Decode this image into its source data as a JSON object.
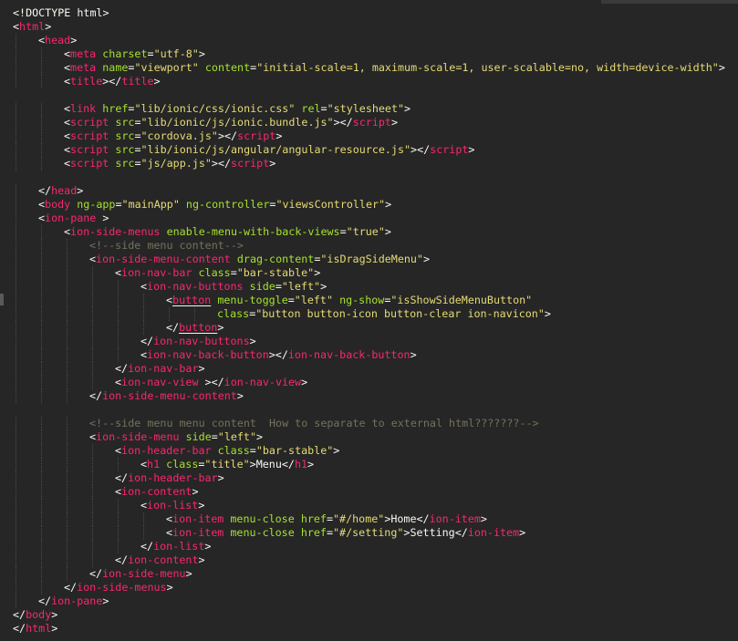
{
  "editor": {
    "theme_colors": {
      "background": "#262626",
      "tag": "#F92672",
      "attribute": "#A6E22E",
      "string": "#E6DB74",
      "text": "#F8F8F2",
      "comment": "#75715E"
    },
    "lines": [
      {
        "indent": 0,
        "tokens": [
          [
            "doctype",
            "<!DOCTYPE html>"
          ]
        ]
      },
      {
        "indent": 0,
        "tokens": [
          [
            "text",
            "<"
          ],
          [
            "tag",
            "html"
          ],
          [
            "text",
            ">"
          ]
        ]
      },
      {
        "indent": 1,
        "tokens": [
          [
            "text",
            "<"
          ],
          [
            "tag",
            "head"
          ],
          [
            "text",
            ">"
          ]
        ]
      },
      {
        "indent": 2,
        "tokens": [
          [
            "text",
            "<"
          ],
          [
            "tag",
            "meta"
          ],
          [
            "text",
            " "
          ],
          [
            "attr",
            "charset"
          ],
          [
            "text",
            "="
          ],
          [
            "str",
            "\"utf-8\""
          ],
          [
            "text",
            ">"
          ]
        ]
      },
      {
        "indent": 2,
        "tokens": [
          [
            "text",
            "<"
          ],
          [
            "tag",
            "meta"
          ],
          [
            "text",
            " "
          ],
          [
            "attr",
            "name"
          ],
          [
            "text",
            "="
          ],
          [
            "str",
            "\"viewport\""
          ],
          [
            "text",
            " "
          ],
          [
            "attr",
            "content"
          ],
          [
            "text",
            "="
          ],
          [
            "str",
            "\"initial-scale=1, maximum-scale=1, user-scalable=no, width=device-width\""
          ],
          [
            "text",
            ">"
          ]
        ]
      },
      {
        "indent": 2,
        "tokens": [
          [
            "text",
            "<"
          ],
          [
            "tag",
            "title"
          ],
          [
            "text",
            "></"
          ],
          [
            "tag",
            "title"
          ],
          [
            "text",
            ">"
          ]
        ]
      },
      {
        "indent": 0,
        "tokens": []
      },
      {
        "indent": 2,
        "tokens": [
          [
            "text",
            "<"
          ],
          [
            "tag",
            "link"
          ],
          [
            "text",
            " "
          ],
          [
            "attr",
            "href"
          ],
          [
            "text",
            "="
          ],
          [
            "str",
            "\"lib/ionic/css/ionic.css\""
          ],
          [
            "text",
            " "
          ],
          [
            "attr",
            "rel"
          ],
          [
            "text",
            "="
          ],
          [
            "str",
            "\"stylesheet\""
          ],
          [
            "text",
            ">"
          ]
        ]
      },
      {
        "indent": 2,
        "tokens": [
          [
            "text",
            "<"
          ],
          [
            "tag",
            "script"
          ],
          [
            "text",
            " "
          ],
          [
            "attr",
            "src"
          ],
          [
            "text",
            "="
          ],
          [
            "str",
            "\"lib/ionic/js/ionic.bundle.js\""
          ],
          [
            "text",
            "></"
          ],
          [
            "tag",
            "script"
          ],
          [
            "text",
            ">"
          ]
        ]
      },
      {
        "indent": 2,
        "tokens": [
          [
            "text",
            "<"
          ],
          [
            "tag",
            "script"
          ],
          [
            "text",
            " "
          ],
          [
            "attr",
            "src"
          ],
          [
            "text",
            "="
          ],
          [
            "str",
            "\"cordova.js\""
          ],
          [
            "text",
            "></"
          ],
          [
            "tag",
            "script"
          ],
          [
            "text",
            ">"
          ]
        ]
      },
      {
        "indent": 2,
        "tokens": [
          [
            "text",
            "<"
          ],
          [
            "tag",
            "script"
          ],
          [
            "text",
            " "
          ],
          [
            "attr",
            "src"
          ],
          [
            "text",
            "="
          ],
          [
            "str",
            "\"lib/ionic/js/angular/angular-resource.js\""
          ],
          [
            "text",
            "></"
          ],
          [
            "tag",
            "script"
          ],
          [
            "text",
            ">"
          ]
        ]
      },
      {
        "indent": 2,
        "tokens": [
          [
            "text",
            "<"
          ],
          [
            "tag",
            "script"
          ],
          [
            "text",
            " "
          ],
          [
            "attr",
            "src"
          ],
          [
            "text",
            "="
          ],
          [
            "str",
            "\"js/app.js\""
          ],
          [
            "text",
            "></"
          ],
          [
            "tag",
            "script"
          ],
          [
            "text",
            ">"
          ]
        ]
      },
      {
        "indent": 0,
        "tokens": []
      },
      {
        "indent": 1,
        "tokens": [
          [
            "text",
            "</"
          ],
          [
            "tag",
            "head"
          ],
          [
            "text",
            ">"
          ]
        ]
      },
      {
        "indent": 1,
        "tokens": [
          [
            "text",
            "<"
          ],
          [
            "tag",
            "body"
          ],
          [
            "text",
            " "
          ],
          [
            "attr",
            "ng-app"
          ],
          [
            "text",
            "="
          ],
          [
            "str",
            "\"mainApp\""
          ],
          [
            "text",
            " "
          ],
          [
            "attr",
            "ng-controller"
          ],
          [
            "text",
            "="
          ],
          [
            "str",
            "\"viewsController\""
          ],
          [
            "text",
            ">"
          ]
        ]
      },
      {
        "indent": 1,
        "tokens": [
          [
            "text",
            "<"
          ],
          [
            "tag",
            "ion-pane"
          ],
          [
            "text",
            " >"
          ]
        ]
      },
      {
        "indent": 2,
        "tokens": [
          [
            "text",
            "<"
          ],
          [
            "tag",
            "ion-side-menus"
          ],
          [
            "text",
            " "
          ],
          [
            "attr",
            "enable-menu-with-back-views"
          ],
          [
            "text",
            "="
          ],
          [
            "str",
            "\"true\""
          ],
          [
            "text",
            ">"
          ]
        ]
      },
      {
        "indent": 3,
        "tokens": [
          [
            "cmt",
            "<!--side menu content-->"
          ]
        ]
      },
      {
        "indent": 3,
        "tokens": [
          [
            "text",
            "<"
          ],
          [
            "tag",
            "ion-side-menu-content"
          ],
          [
            "text",
            " "
          ],
          [
            "attr",
            "drag-content"
          ],
          [
            "text",
            "="
          ],
          [
            "str",
            "\"isDragSideMenu\""
          ],
          [
            "text",
            ">"
          ]
        ]
      },
      {
        "indent": 4,
        "tokens": [
          [
            "text",
            "<"
          ],
          [
            "tag",
            "ion-nav-bar"
          ],
          [
            "text",
            " "
          ],
          [
            "attr",
            "class"
          ],
          [
            "text",
            "="
          ],
          [
            "str",
            "\"bar-stable\""
          ],
          [
            "text",
            ">"
          ]
        ]
      },
      {
        "indent": 5,
        "tokens": [
          [
            "text",
            "<"
          ],
          [
            "tag",
            "ion-nav-buttons"
          ],
          [
            "text",
            " "
          ],
          [
            "attr",
            "side"
          ],
          [
            "text",
            "="
          ],
          [
            "str",
            "\"left\""
          ],
          [
            "text",
            ">"
          ]
        ]
      },
      {
        "indent": 6,
        "tokens": [
          [
            "text",
            "<"
          ],
          [
            "tagul",
            "button"
          ],
          [
            "text",
            " "
          ],
          [
            "attr",
            "menu-toggle"
          ],
          [
            "text",
            "="
          ],
          [
            "str",
            "\"left\""
          ],
          [
            "text",
            " "
          ],
          [
            "attr",
            "ng-show"
          ],
          [
            "text",
            "="
          ],
          [
            "str",
            "\"isShowSideMenuButton\""
          ]
        ]
      },
      {
        "indent": 8,
        "tokens": [
          [
            "attr",
            "class"
          ],
          [
            "text",
            "="
          ],
          [
            "str",
            "\"button button-icon button-clear ion-navicon\""
          ],
          [
            "text",
            ">"
          ]
        ]
      },
      {
        "indent": 6,
        "tokens": [
          [
            "text",
            "</"
          ],
          [
            "tagul",
            "button"
          ],
          [
            "text",
            ">"
          ]
        ]
      },
      {
        "indent": 5,
        "tokens": [
          [
            "text",
            "</"
          ],
          [
            "tag",
            "ion-nav-buttons"
          ],
          [
            "text",
            ">"
          ]
        ]
      },
      {
        "indent": 5,
        "tokens": [
          [
            "text",
            "<"
          ],
          [
            "tag",
            "ion-nav-back-button"
          ],
          [
            "text",
            "></"
          ],
          [
            "tag",
            "ion-nav-back-button"
          ],
          [
            "text",
            ">"
          ]
        ]
      },
      {
        "indent": 4,
        "tokens": [
          [
            "text",
            "</"
          ],
          [
            "tag",
            "ion-nav-bar"
          ],
          [
            "text",
            ">"
          ]
        ]
      },
      {
        "indent": 4,
        "tokens": [
          [
            "text",
            "<"
          ],
          [
            "tag",
            "ion-nav-view"
          ],
          [
            "text",
            " ></"
          ],
          [
            "tag",
            "ion-nav-view"
          ],
          [
            "text",
            ">"
          ]
        ]
      },
      {
        "indent": 3,
        "tokens": [
          [
            "text",
            "</"
          ],
          [
            "tag",
            "ion-side-menu-content"
          ],
          [
            "text",
            ">"
          ]
        ]
      },
      {
        "indent": 0,
        "tokens": []
      },
      {
        "indent": 3,
        "tokens": [
          [
            "cmt",
            "<!--side menu menu content  How to separate to external html???????-->"
          ]
        ]
      },
      {
        "indent": 3,
        "tokens": [
          [
            "text",
            "<"
          ],
          [
            "tag",
            "ion-side-menu"
          ],
          [
            "text",
            " "
          ],
          [
            "attr",
            "side"
          ],
          [
            "text",
            "="
          ],
          [
            "str",
            "\"left\""
          ],
          [
            "text",
            ">"
          ]
        ]
      },
      {
        "indent": 4,
        "tokens": [
          [
            "text",
            "<"
          ],
          [
            "tag",
            "ion-header-bar"
          ],
          [
            "text",
            " "
          ],
          [
            "attr",
            "class"
          ],
          [
            "text",
            "="
          ],
          [
            "str",
            "\"bar-stable\""
          ],
          [
            "text",
            ">"
          ]
        ]
      },
      {
        "indent": 5,
        "tokens": [
          [
            "text",
            "<"
          ],
          [
            "tag",
            "h1"
          ],
          [
            "text",
            " "
          ],
          [
            "attr",
            "class"
          ],
          [
            "text",
            "="
          ],
          [
            "str",
            "\"title\""
          ],
          [
            "text",
            ">Menu</"
          ],
          [
            "tag",
            "h1"
          ],
          [
            "text",
            ">"
          ]
        ]
      },
      {
        "indent": 4,
        "tokens": [
          [
            "text",
            "</"
          ],
          [
            "tag",
            "ion-header-bar"
          ],
          [
            "text",
            ">"
          ]
        ]
      },
      {
        "indent": 4,
        "tokens": [
          [
            "text",
            "<"
          ],
          [
            "tag",
            "ion-content"
          ],
          [
            "text",
            ">"
          ]
        ]
      },
      {
        "indent": 5,
        "tokens": [
          [
            "text",
            "<"
          ],
          [
            "tag",
            "ion-list"
          ],
          [
            "text",
            ">"
          ]
        ]
      },
      {
        "indent": 6,
        "tokens": [
          [
            "text",
            "<"
          ],
          [
            "tag",
            "ion-item"
          ],
          [
            "text",
            " "
          ],
          [
            "attr",
            "menu-close"
          ],
          [
            "text",
            " "
          ],
          [
            "attr",
            "href"
          ],
          [
            "text",
            "="
          ],
          [
            "str",
            "\"#/home\""
          ],
          [
            "text",
            ">Home</"
          ],
          [
            "tag",
            "ion-item"
          ],
          [
            "text",
            ">"
          ]
        ]
      },
      {
        "indent": 6,
        "tokens": [
          [
            "text",
            "<"
          ],
          [
            "tag",
            "ion-item"
          ],
          [
            "text",
            " "
          ],
          [
            "attr",
            "menu-close"
          ],
          [
            "text",
            " "
          ],
          [
            "attr",
            "href"
          ],
          [
            "text",
            "="
          ],
          [
            "str",
            "\"#/setting\""
          ],
          [
            "text",
            ">Setting</"
          ],
          [
            "tag",
            "ion-item"
          ],
          [
            "text",
            ">"
          ]
        ]
      },
      {
        "indent": 5,
        "tokens": [
          [
            "text",
            "</"
          ],
          [
            "tag",
            "ion-list"
          ],
          [
            "text",
            ">"
          ]
        ]
      },
      {
        "indent": 4,
        "tokens": [
          [
            "text",
            "</"
          ],
          [
            "tag",
            "ion-content"
          ],
          [
            "text",
            ">"
          ]
        ]
      },
      {
        "indent": 3,
        "tokens": [
          [
            "text",
            "</"
          ],
          [
            "tag",
            "ion-side-menu"
          ],
          [
            "text",
            ">"
          ]
        ]
      },
      {
        "indent": 2,
        "tokens": [
          [
            "text",
            "</"
          ],
          [
            "tag",
            "ion-side-menus"
          ],
          [
            "text",
            ">"
          ]
        ]
      },
      {
        "indent": 1,
        "tokens": [
          [
            "text",
            "</"
          ],
          [
            "tag",
            "ion-pane"
          ],
          [
            "text",
            ">"
          ]
        ]
      },
      {
        "indent": 0,
        "tokens": [
          [
            "text",
            "</"
          ],
          [
            "tag",
            "body"
          ],
          [
            "text",
            ">"
          ]
        ]
      },
      {
        "indent": 0,
        "tokens": [
          [
            "text",
            "</"
          ],
          [
            "tag",
            "html"
          ],
          [
            "text",
            ">"
          ]
        ]
      }
    ]
  }
}
